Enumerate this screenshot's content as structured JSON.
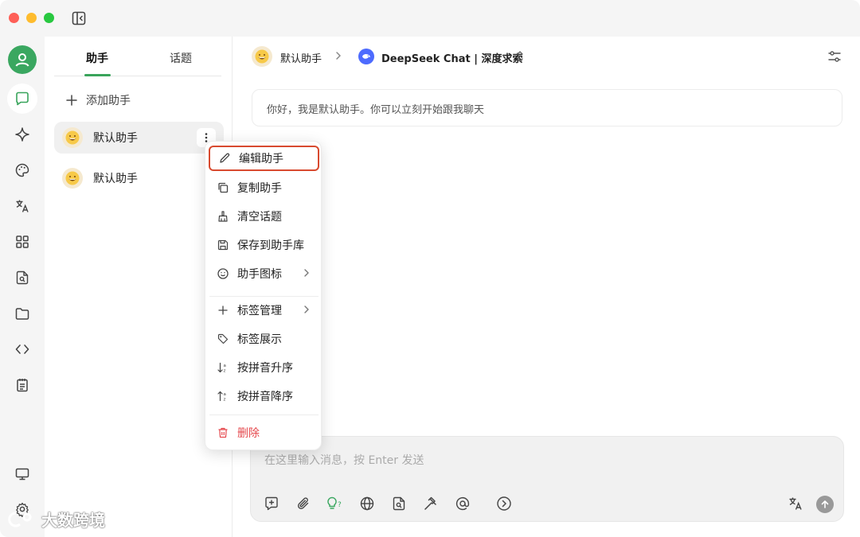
{
  "window": {
    "traffic_lights": [
      "red",
      "yellow",
      "green"
    ]
  },
  "rail": {
    "items": [
      {
        "name": "user-avatar-icon"
      },
      {
        "name": "chat-icon",
        "active": true
      },
      {
        "name": "sparkle-icon"
      },
      {
        "name": "palette-icon"
      },
      {
        "name": "translate-icon"
      },
      {
        "name": "apps-grid-icon"
      },
      {
        "name": "file-search-icon"
      },
      {
        "name": "folder-icon"
      },
      {
        "name": "code-icon"
      },
      {
        "name": "notepad-icon"
      },
      {
        "name": "monitor-icon"
      },
      {
        "name": "settings-gear-icon"
      }
    ]
  },
  "panel": {
    "tabs": [
      {
        "label": "助手",
        "active": true
      },
      {
        "label": "话题",
        "active": false
      }
    ],
    "add_label": "添加助手",
    "assistants": [
      {
        "name": "默认助手",
        "selected": true
      },
      {
        "name": "默认助手",
        "selected": false
      }
    ]
  },
  "header": {
    "assistant_name": "默认助手",
    "model_name": "DeepSeek Chat | 深度求索"
  },
  "chat": {
    "greeting": "你好，我是默认助手。你可以立刻开始跟我聊天"
  },
  "input": {
    "placeholder": "在这里输入消息，按 Enter 发送",
    "tools": [
      "new-topic-icon",
      "attachment-icon",
      "thinking-bulb-icon",
      "web-search-icon",
      "knowledge-file-icon",
      "tools-hammer-icon",
      "mention-at-icon",
      "expand-circle-icon"
    ]
  },
  "context_menu": {
    "items": [
      {
        "label": "编辑助手",
        "icon": "pencil-icon",
        "highlight": true
      },
      {
        "label": "复制助手",
        "icon": "copy-icon"
      },
      {
        "label": "清空话题",
        "icon": "broom-icon"
      },
      {
        "label": "保存到助手库",
        "icon": "save-icon"
      },
      {
        "label": "助手图标",
        "icon": "smile-icon",
        "submenu": true
      },
      {
        "label": "标签管理",
        "icon": "plus-icon",
        "submenu": true
      },
      {
        "label": "标签展示",
        "icon": "tag-icon"
      },
      {
        "label": "按拼音升序",
        "icon": "sort-asc-icon"
      },
      {
        "label": "按拼音降序",
        "icon": "sort-desc-icon"
      },
      {
        "label": "删除",
        "icon": "trash-icon",
        "danger": true
      }
    ]
  },
  "watermark": {
    "text": "大数跨境"
  },
  "colors": {
    "accent": "#39a45b",
    "danger": "#e5484d",
    "highlight_border": "#d84a2f",
    "deepseek": "#4d6bfe"
  }
}
